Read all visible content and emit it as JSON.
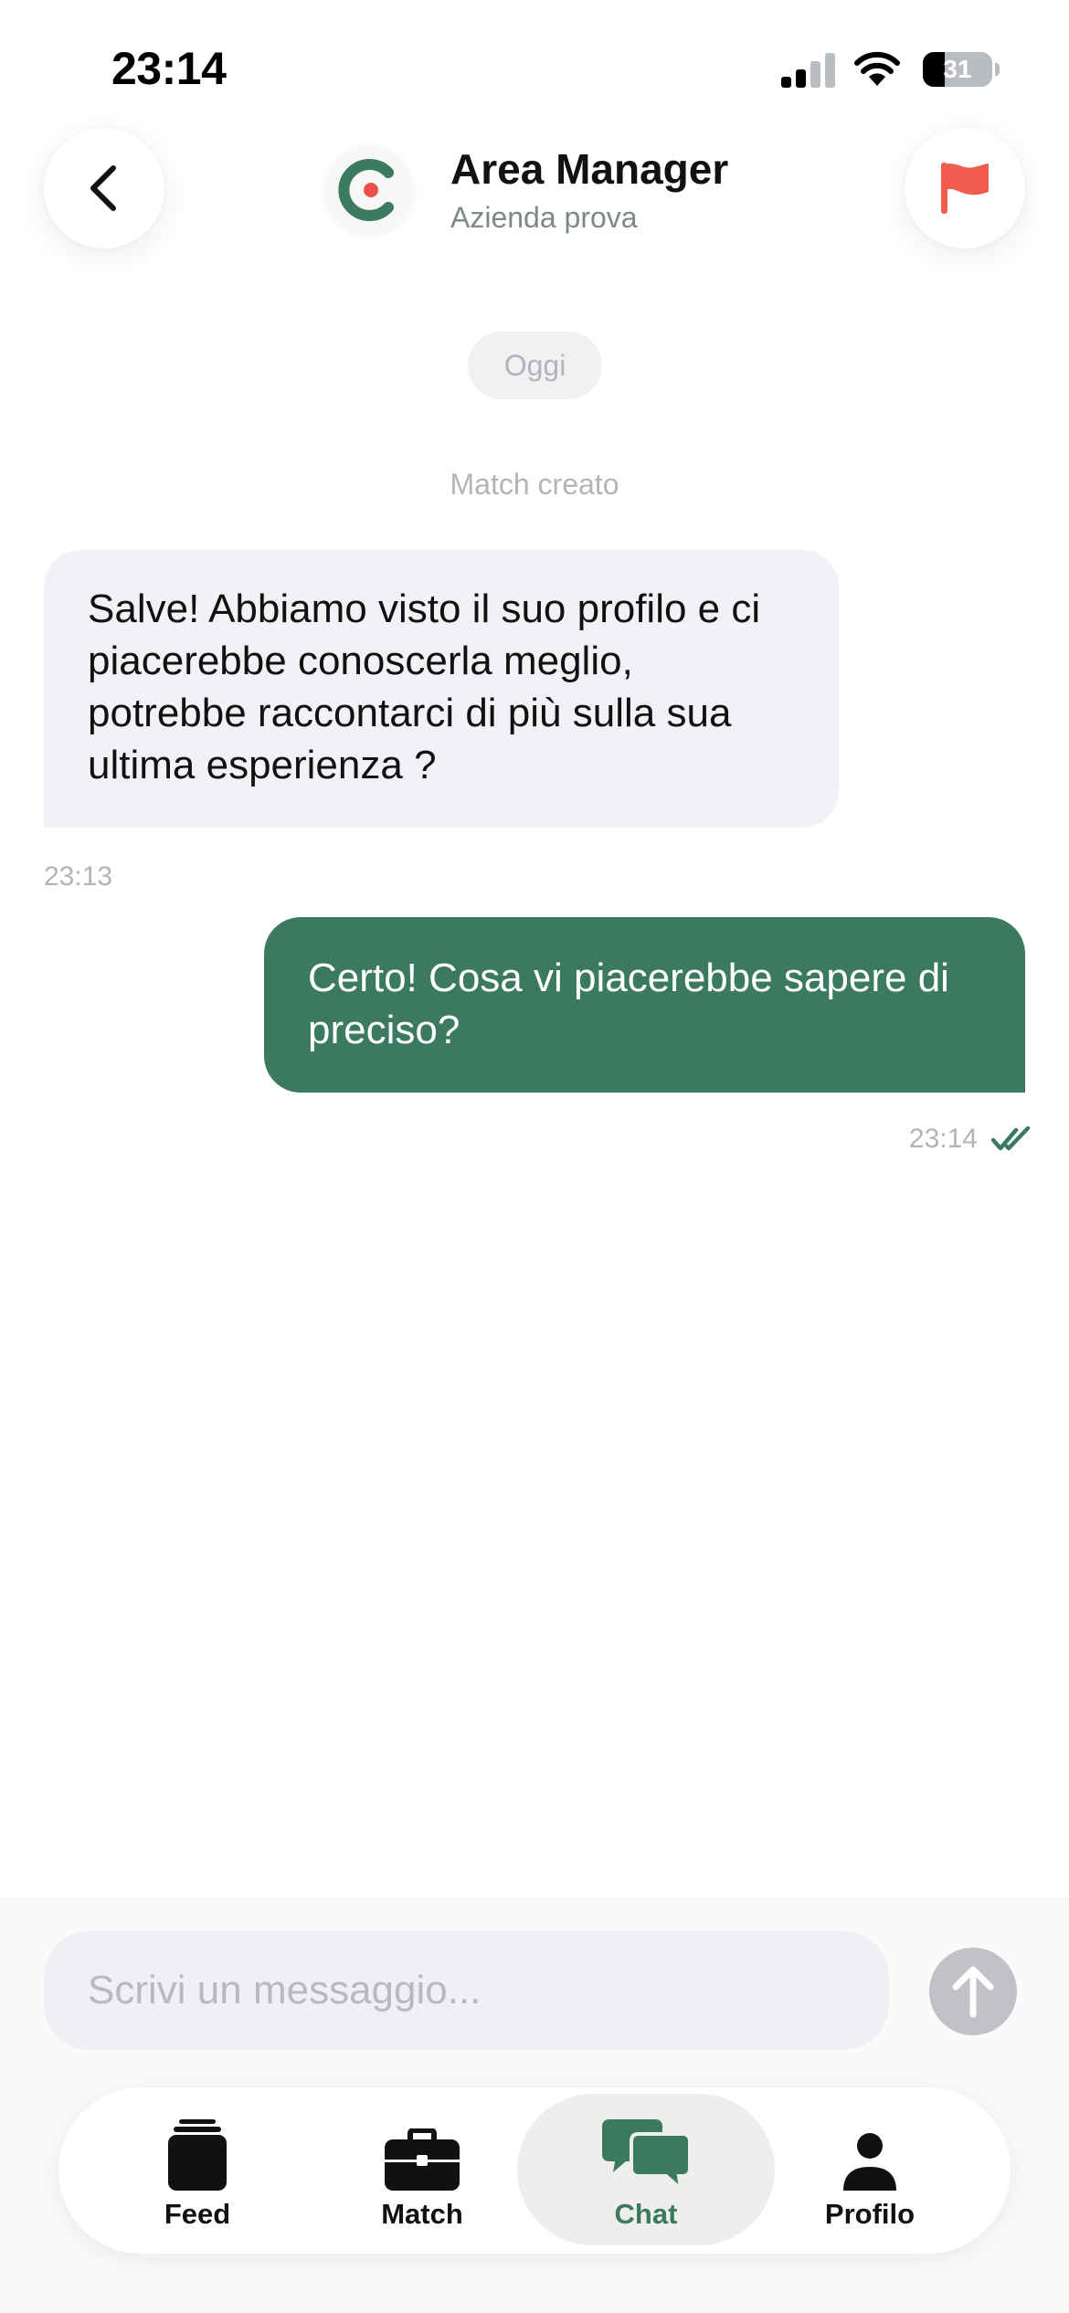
{
  "status_bar": {
    "time": "23:14",
    "battery_level": "31",
    "battery_fraction": 0.31,
    "icons": [
      "cellular-signal-icon",
      "wifi-icon",
      "battery-icon"
    ]
  },
  "header": {
    "title": "Area Manager",
    "subtitle": "Azienda prova",
    "back_icon": "chevron-left-icon",
    "report_icon": "flag-icon",
    "report_color": "#f25c4f",
    "avatar_icon": "company-logo-icon"
  },
  "chat": {
    "date_label": "Oggi",
    "system_message": "Match creato",
    "messages": [
      {
        "direction": "incoming",
        "text": "Salve! Abbiamo visto il suo profilo e ci piacerebbe conoscerla meglio, potrebbe raccontarci di più sulla sua ultima esperienza ?",
        "time": "23:13"
      },
      {
        "direction": "outgoing",
        "text": "Certo! Cosa vi piacerebbe sapere di preciso?",
        "time": "23:14",
        "status_icon": "double-check-icon"
      }
    ]
  },
  "composer": {
    "placeholder": "Scrivi un messaggio...",
    "send_icon": "arrow-up-icon"
  },
  "tabs": [
    {
      "label": "Feed",
      "icon": "cards-icon",
      "active": false
    },
    {
      "label": "Match",
      "icon": "briefcase-icon",
      "active": false
    },
    {
      "label": "Chat",
      "icon": "chat-bubbles-icon",
      "active": true
    },
    {
      "label": "Profilo",
      "icon": "person-icon",
      "active": false
    }
  ],
  "colors": {
    "brand_green": "#3b7a60",
    "accent_red": "#f25c4f",
    "incoming_bubble": "#f2f2f6",
    "muted_text": "#b3b3b8"
  }
}
